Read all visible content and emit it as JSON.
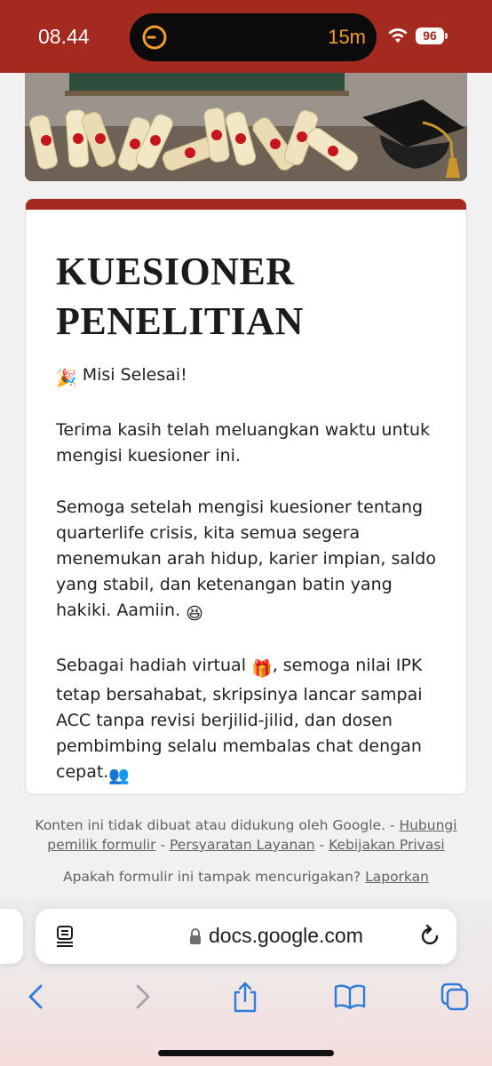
{
  "status_bar": {
    "time": "08.44",
    "timer": "15m",
    "battery": "96"
  },
  "form": {
    "title": "KUESIONER PENELITIAN",
    "paragraphs": {
      "p1": "Misi Selesai!",
      "p2": "Terima kasih telah meluangkan waktu untuk mengisi kuesioner ini.",
      "p3": "Semoga setelah mengisi kuesioner tentang quarterlife crisis, kita semua segera menemukan arah hidup, karier impian, saldo yang stabil, dan ketenangan batin yang hakiki. Aamiin.",
      "p4a": "Sebagai hadiah virtual",
      "p4b": ", semoga nilai IPK tetap bersahabat, skripsinya lancar sampai ACC tanpa revisi berjilid-jilid, dan dosen pembimbing selalu membalas chat dengan cepat."
    },
    "emojis": {
      "party": "🎉",
      "grin": "😆",
      "gift": "🎁",
      "people": "👥"
    }
  },
  "footer": {
    "disclaimer": "Konten ini tidak dibuat atau didukung oleh Google. -",
    "contact_link": "Hubungi pemilik formulir",
    "sep1": "-",
    "terms_link": "Persyaratan Layanan",
    "sep2": "-",
    "privacy_link": "Kebijakan Privasi",
    "suspicious": "Apakah formulir ini tampak mencurigakan?",
    "report_link": "Laporkan"
  },
  "browser": {
    "url": "docs.google.com",
    "icons": [
      "reader-icon",
      "lock-icon",
      "reload-icon",
      "back-icon",
      "forward-icon",
      "share-icon",
      "bookmarks-icon",
      "tabs-icon"
    ]
  },
  "colors": {
    "accent": "#a4291f",
    "link": "#5f6368",
    "toolbar_icon": "#2f7bd8"
  }
}
